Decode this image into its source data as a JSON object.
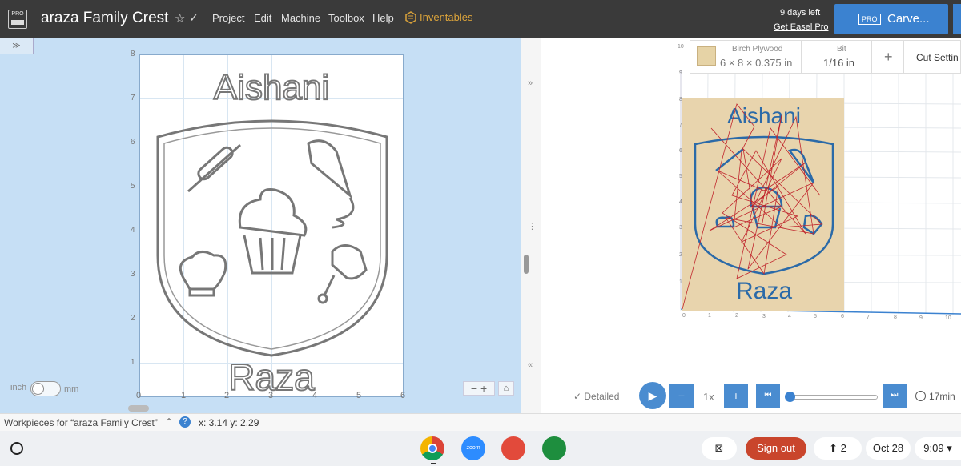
{
  "app": {
    "project_name": "araza Family Crest",
    "menus": [
      "Project",
      "Edit",
      "Machine",
      "Toolbox",
      "Help"
    ],
    "inventables_label": "Inventables",
    "trial": {
      "days_left": "9 days left",
      "upgrade_link": "Get Easel Pro"
    },
    "carve": {
      "badge": "PRO",
      "label": "Carve..."
    }
  },
  "design": {
    "y_ticks": [
      "8",
      "7",
      "6",
      "5",
      "4",
      "3",
      "2",
      "1"
    ],
    "x_ticks": [
      "0",
      "1",
      "2",
      "3",
      "4",
      "5",
      "6"
    ],
    "top_text": "Aishani",
    "bottom_text": "Raza",
    "units": {
      "left": "inch",
      "right": "mm"
    },
    "zoom_label": "− +",
    "home_icon": "home-icon"
  },
  "preview": {
    "material": {
      "name": "Birch Plywood",
      "size": "6 × 8 × 0.375 in"
    },
    "bit": {
      "label": "Bit",
      "value": "1/16 in"
    },
    "cut_settings": "Cut Settin",
    "top_text": "Aishani",
    "bottom_text": "Raza",
    "x_ticks": [
      "0",
      "1",
      "2",
      "3",
      "4",
      "5",
      "6",
      "7",
      "8",
      "9",
      "10"
    ],
    "y_ticks": [
      "10",
      "9",
      "8",
      "7",
      "6",
      "5",
      "4",
      "3",
      "2",
      "1"
    ],
    "detail_label": "✓  Detailed",
    "speed": "1x",
    "time": "17min",
    "progress": 0.0
  },
  "status": {
    "workpieces": "Workpieces for “araza Family Crest”",
    "coords": "x: 3.14 y: 2.29"
  },
  "taskbar": {
    "zoom_app": "zoom",
    "sign_out": "Sign out",
    "notif_count": "2",
    "date": "Oct 28",
    "time": "9:09"
  },
  "colors": {
    "accent": "#3b82d0",
    "topbar": "#3a3a3a",
    "workspace": "#c6dff5",
    "toolpath": "#c0262d",
    "carve_blue": "#2b6aa8"
  }
}
